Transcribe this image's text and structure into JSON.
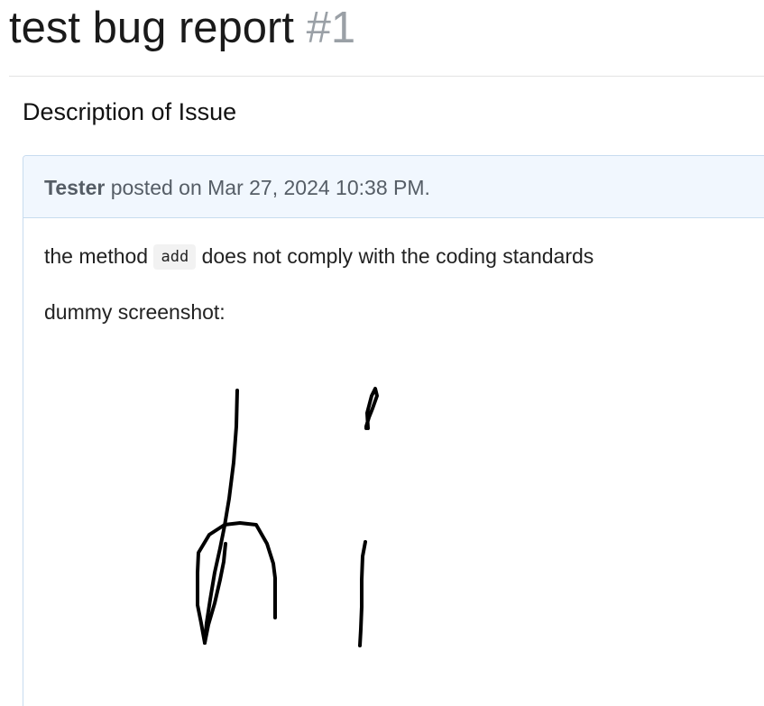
{
  "issue": {
    "title": "test bug report",
    "number": "#1"
  },
  "section": {
    "heading": "Description of Issue"
  },
  "comment": {
    "author": "Tester",
    "posted_text": " posted on Mar 27, 2024 10:38 PM.",
    "body": {
      "line1_before": "the method ",
      "code": "add",
      "line1_after": " does not comply with the coding standards",
      "line2": "dummy screenshot:"
    },
    "image_content": "handwritten \"hi\""
  },
  "colors": {
    "header_background": "#f1f7fe",
    "card_border": "#c8dcef",
    "issue_number": "#9aa0a6",
    "meta_text": "#555d66"
  }
}
